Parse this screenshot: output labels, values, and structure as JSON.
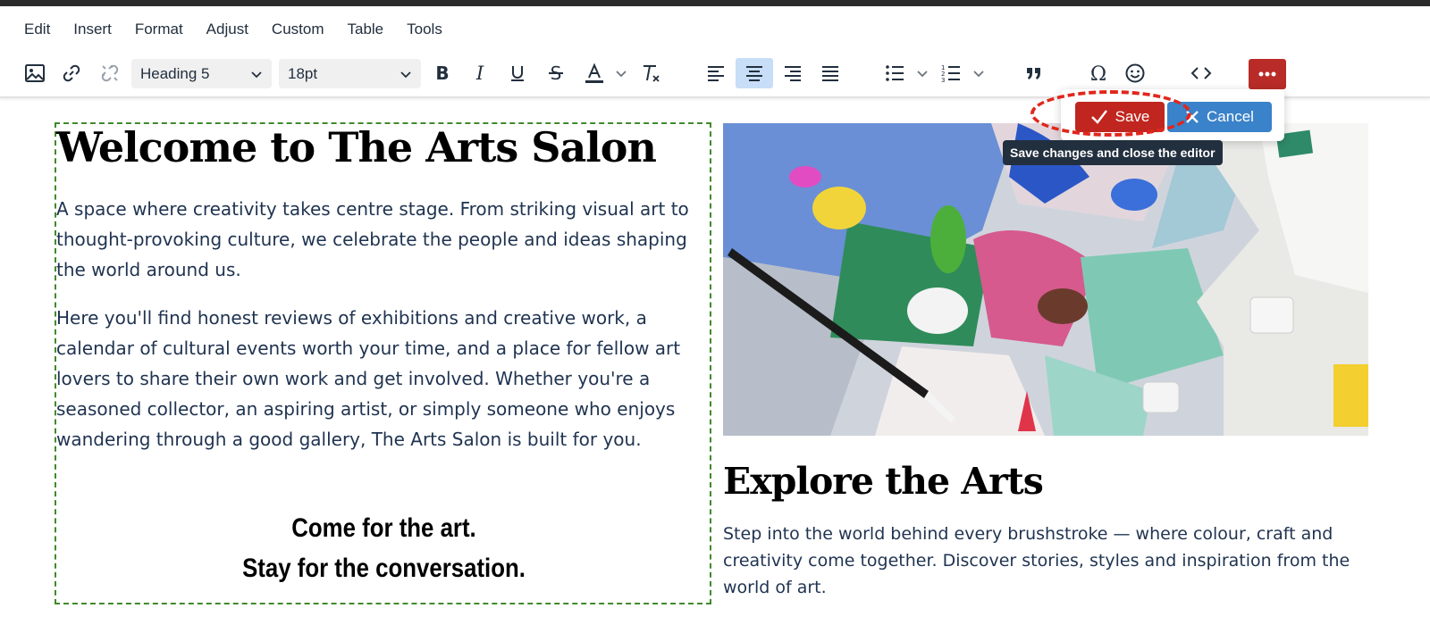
{
  "menubar": {
    "items": [
      "Edit",
      "Insert",
      "Format",
      "Adjust",
      "Custom",
      "Table",
      "Tools"
    ]
  },
  "toolbar": {
    "block_format": "Heading 5",
    "font_size": "18pt",
    "icons": [
      "image-icon",
      "link-icon",
      "unlink-icon",
      "bold-icon",
      "italic-icon",
      "underline-icon",
      "strikethrough-icon",
      "text-color-icon",
      "clear-formatting-icon",
      "align-left-icon",
      "align-center-icon",
      "align-right-icon",
      "justify-icon",
      "bullet-list-icon",
      "numbered-list-icon",
      "blockquote-icon",
      "special-character-icon",
      "emoji-icon",
      "source-code-icon",
      "more-icon"
    ],
    "active_alignment": "center",
    "text_color": "#222f3e",
    "more_button_color": "#b92b27"
  },
  "popup": {
    "save_label": "Save",
    "cancel_label": "Cancel",
    "tooltip": "Save changes and close the editor",
    "save_color": "#c0261f",
    "cancel_color": "#3a82c9"
  },
  "content": {
    "title": "Welcome to The Arts Salon",
    "paragraph1": "A space where creativity takes centre stage. From striking visual art to thought-provoking culture, we celebrate the people and ideas shaping the world around us.",
    "paragraph2": "Here you'll find honest reviews of exhibitions and creative work, a calendar of cultural events worth your time, and a place for fellow art lovers to share their own work and get involved. Whether you're a seasoned collector, an aspiring artist, or simply someone who enjoys wandering through a good gallery, The Arts Salon is built for you.",
    "tagline1": "Come for the art.",
    "tagline2": "Stay for the conversation.",
    "explore_title": "Explore the Arts",
    "explore_text": "Step into the world behind every brushstroke — where colour, craft and creativity come together. Discover stories, styles and inspiration from the world of art."
  },
  "colors": {
    "selection_border": "#3f8a2b",
    "highlight_ring": "#e1261c",
    "body_text": "#1f3350"
  }
}
